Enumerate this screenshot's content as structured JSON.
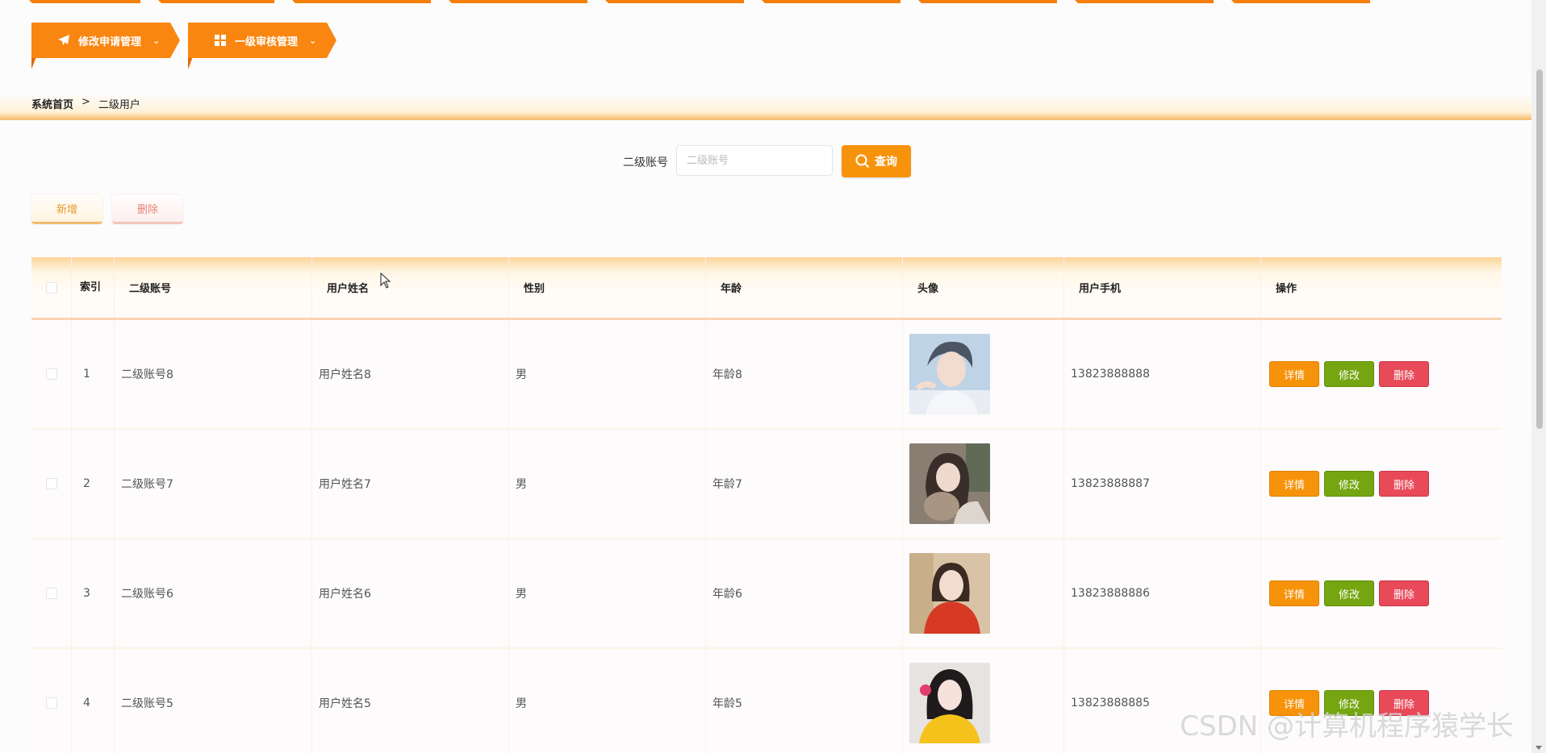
{
  "nav": {
    "items": [
      {
        "label": "修改申请管理",
        "icon": "paper-plane-icon"
      },
      {
        "label": "一级审核管理",
        "icon": "grid-icon"
      }
    ]
  },
  "breadcrumb": {
    "home": "系统首页",
    "separator": ">",
    "current": "二级用户"
  },
  "search": {
    "label": "二级账号",
    "placeholder": "二级账号",
    "value": "",
    "button": "查询"
  },
  "actions": {
    "add": "新增",
    "delete": "删除"
  },
  "table": {
    "headers": {
      "index": "索引",
      "account": "二级账号",
      "name": "用户姓名",
      "gender": "性别",
      "age": "年龄",
      "avatar": "头像",
      "phone": "用户手机",
      "ops": "操作"
    },
    "rows": [
      {
        "index": "1",
        "account": "二级账号8",
        "name": "用户姓名8",
        "gender": "男",
        "age": "年龄8",
        "phone": "13823888888",
        "avatar": "avatar-young-man"
      },
      {
        "index": "2",
        "account": "二级账号7",
        "name": "用户姓名7",
        "gender": "男",
        "age": "年龄7",
        "phone": "13823888887",
        "avatar": "avatar-girl-with-cat"
      },
      {
        "index": "3",
        "account": "二级账号6",
        "name": "用户姓名6",
        "gender": "男",
        "age": "年龄6",
        "phone": "13823888886",
        "avatar": "avatar-girl-red-jacket"
      },
      {
        "index": "4",
        "account": "二级账号5",
        "name": "用户姓名5",
        "gender": "男",
        "age": "年龄5",
        "phone": "13823888885",
        "avatar": "avatar-girl-yellow"
      }
    ],
    "row_ops": {
      "detail": "详情",
      "edit": "修改",
      "delete": "删除"
    }
  },
  "watermark": "CSDN @计算机程序猿学长",
  "colors": {
    "primary": "#f98611",
    "query": "#f7930b",
    "edit": "#75a611",
    "delete": "#e84a5a"
  }
}
